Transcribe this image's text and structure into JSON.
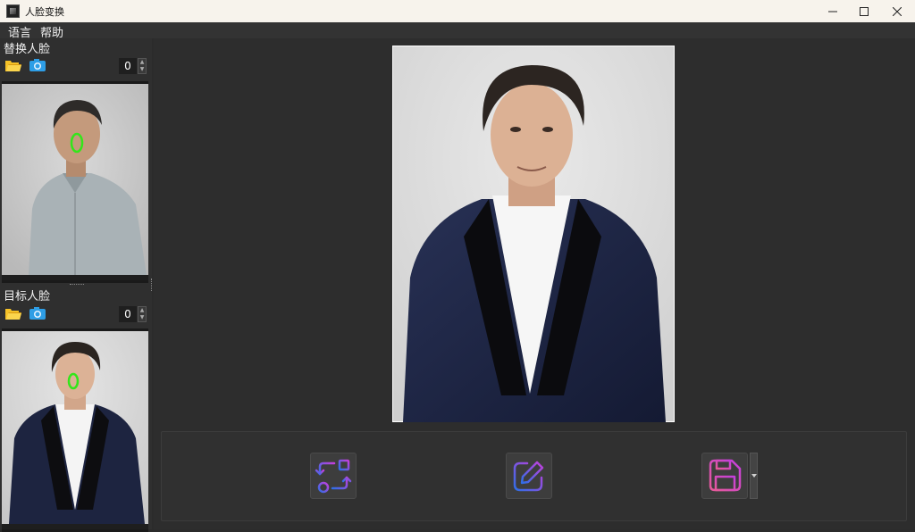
{
  "window": {
    "title": "人脸变换",
    "controls": {
      "minimize": "—",
      "maximize": "☐",
      "close": "✕"
    }
  },
  "menu": {
    "items": [
      "语言",
      "帮助"
    ]
  },
  "source_face": {
    "label": "替换人脸",
    "index": "0"
  },
  "target_face": {
    "label": "目标人脸",
    "index": "0"
  },
  "actions": [
    "swap-icon",
    "edit-icon",
    "save-icon"
  ],
  "colors": {
    "face_marker": "#33e61a",
    "accent_gradient_start": "#c53fdc",
    "accent_gradient_end": "#2f6ee6",
    "folder": "#f5c127",
    "camera": "#2e9ee6"
  }
}
